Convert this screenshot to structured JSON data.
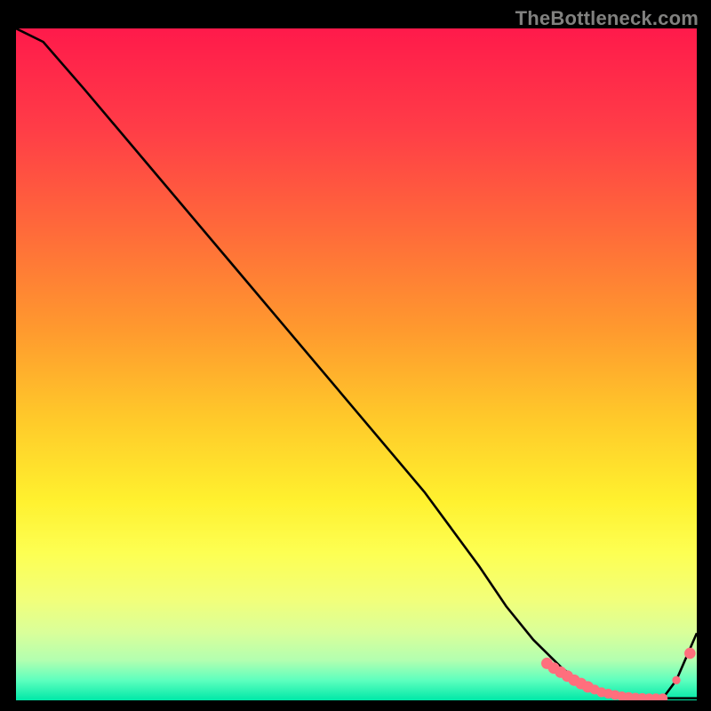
{
  "watermark": "TheBottleneck.com",
  "colors": {
    "bg": "#000000",
    "gradient_stops": [
      {
        "offset": 0.0,
        "color": "#ff1a4b"
      },
      {
        "offset": 0.15,
        "color": "#ff3d47"
      },
      {
        "offset": 0.3,
        "color": "#ff6a3a"
      },
      {
        "offset": 0.45,
        "color": "#ff9a2e"
      },
      {
        "offset": 0.58,
        "color": "#ffc92a"
      },
      {
        "offset": 0.7,
        "color": "#fff02e"
      },
      {
        "offset": 0.78,
        "color": "#fdff52"
      },
      {
        "offset": 0.85,
        "color": "#f2ff7a"
      },
      {
        "offset": 0.9,
        "color": "#d9ff9a"
      },
      {
        "offset": 0.94,
        "color": "#b3ffb0"
      },
      {
        "offset": 0.97,
        "color": "#5effbe"
      },
      {
        "offset": 1.0,
        "color": "#00e8a8"
      }
    ],
    "curve": "#000000",
    "marker_fill": "#ff6f7d",
    "marker_stroke": "#ff6f7d"
  },
  "chart_data": {
    "type": "line",
    "title": "",
    "xlabel": "",
    "ylabel": "",
    "xlim": [
      0,
      100
    ],
    "ylim": [
      0,
      100
    ],
    "series": [
      {
        "name": "curve",
        "x": [
          0,
          4,
          10,
          20,
          30,
          40,
          50,
          60,
          68,
          72,
          76,
          80,
          83,
          86,
          89,
          92,
          95,
          100
        ],
        "y": [
          100,
          98,
          91,
          79,
          67,
          55,
          43,
          31,
          20,
          14,
          9,
          5,
          2.5,
          1.2,
          0.6,
          0.4,
          0.3,
          0.3
        ]
      },
      {
        "name": "tail-rise",
        "x": [
          95,
          97,
          100
        ],
        "y": [
          0.3,
          3.0,
          10
        ]
      }
    ],
    "markers": {
      "name": "highlight-points",
      "x": [
        78,
        79,
        80,
        81,
        82,
        83,
        84,
        85,
        86,
        87,
        88,
        89,
        90,
        91,
        92,
        93,
        94,
        95,
        97,
        99
      ],
      "y": [
        5.5,
        4.8,
        4.2,
        3.6,
        3.0,
        2.5,
        2.0,
        1.6,
        1.2,
        1.0,
        0.8,
        0.6,
        0.5,
        0.4,
        0.35,
        0.3,
        0.3,
        0.3,
        3.0,
        7.0
      ],
      "r": [
        6,
        6,
        6,
        6,
        6,
        6,
        6,
        5,
        5,
        5,
        5,
        5,
        5,
        5,
        5,
        5,
        5,
        5,
        4.2,
        5.8
      ]
    }
  }
}
